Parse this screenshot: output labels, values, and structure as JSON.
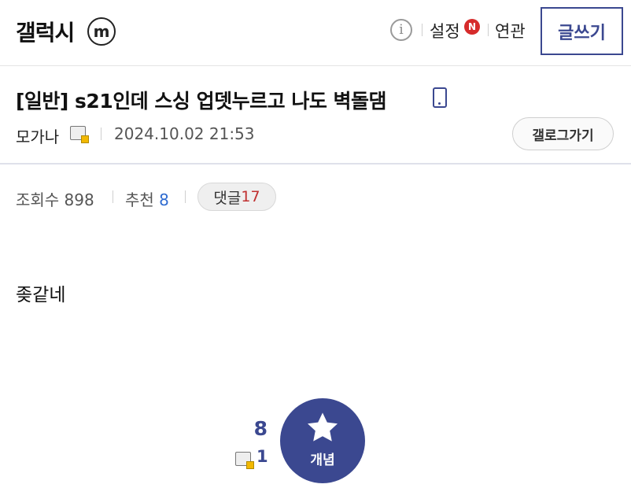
{
  "header": {
    "gallery_name": "갤럭시",
    "minor_badge": "m",
    "info_icon": "i",
    "settings_label": "설정",
    "new_badge": "N",
    "related_label": "연관",
    "write_label": "글쓰기"
  },
  "post": {
    "title": "[일반] s21인데 스싱 업뎃누르고 나도 벽돌댐",
    "device_icon": "mobile-phone-icon",
    "author": "모가나",
    "date": "2024.10.02 21:53",
    "gallog_label": "갤로그가기",
    "views_label": "조회수 898",
    "recommend_label": "추천",
    "recommend_count": "8",
    "comments_label": "댓글",
    "comments_count": "17",
    "body": "좆같네"
  },
  "recommend": {
    "count": "8",
    "fixed_count": "1",
    "button_label": "개념"
  },
  "colors": {
    "accent": "#3b4890",
    "new_badge": "#d62b2b",
    "comment_count": "#c03030",
    "recommend_count_blue": "#2f6bd0"
  }
}
